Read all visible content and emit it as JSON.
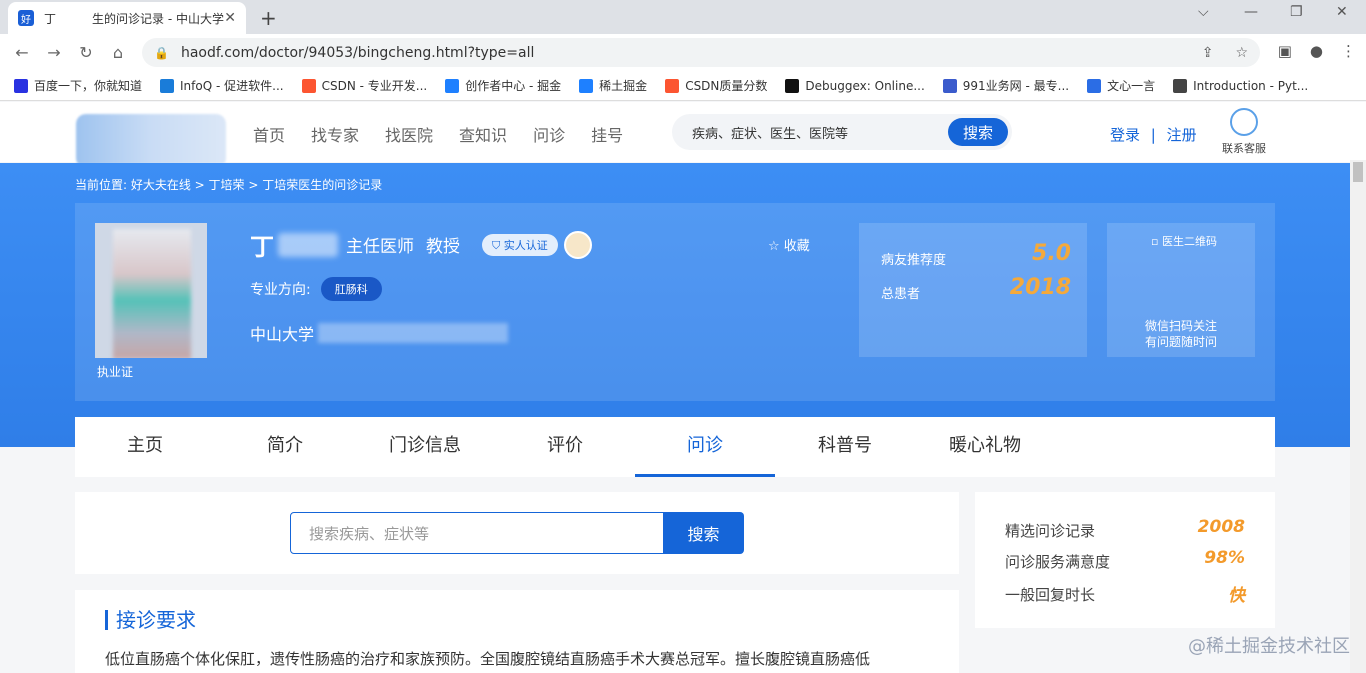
{
  "browser": {
    "tab_title": "丁　　　生的问诊记录 - 中山大学",
    "tab_close": "✕",
    "new_tab": "+",
    "win_min": "⌵",
    "win_minimize": "—",
    "win_restore": "❐",
    "win_close": "✕",
    "url": "haodf.com/doctor/94053/bingcheng.html?type=all",
    "bookmarks": [
      {
        "label": "百度一下，你就知道",
        "icon": "baidu-icon",
        "color": "#2932e1"
      },
      {
        "label": "InfoQ - 促进软件...",
        "icon": "infoq-icon",
        "color": "#1a7cd9"
      },
      {
        "label": "CSDN - 专业开发...",
        "icon": "csdn-icon",
        "color": "#fc5531"
      },
      {
        "label": "创作者中心 - 掘金",
        "icon": "juejin-icon",
        "color": "#1e80ff"
      },
      {
        "label": "稀土掘金",
        "icon": "juejin-icon",
        "color": "#1e80ff"
      },
      {
        "label": "CSDN质量分数",
        "icon": "csdn-icon",
        "color": "#fc5531"
      },
      {
        "label": "Debuggex: Online...",
        "icon": "debuggex-icon",
        "color": "#111111"
      },
      {
        "label": "991业务网 - 最专...",
        "icon": "991-icon",
        "color": "#3b5bcc"
      },
      {
        "label": "文心一言",
        "icon": "wenxin-icon",
        "color": "#2b6de5"
      },
      {
        "label": "Introduction - Pyt...",
        "icon": "python-icon",
        "color": "#444444"
      }
    ]
  },
  "site": {
    "nav": [
      "首页",
      "找专家",
      "找医院",
      "查知识",
      "问诊",
      "挂号"
    ],
    "search_placeholder": "疾病、症状、医生、医院等",
    "search_button": "搜索",
    "login": "登录",
    "separator": "|",
    "register": "注册",
    "service": "联系客服"
  },
  "doctor": {
    "breadcrumb": "当前位置: 好大夫在线  > 丁培荣  > 丁培荣医生的问诊记录",
    "surname": "丁",
    "title": "主任医师",
    "academic": "教授",
    "verified": "实人认证",
    "specialty_label": "专业方向:",
    "specialty_tag": "肛肠科",
    "hospital": "中山大学",
    "license": "执业证",
    "favorite": "☆ 收藏",
    "rec_label": "病友推荐度",
    "rec_value": "5.0",
    "patients_label": "总患者",
    "patients_value": "2018",
    "qr_alt": "医生二维码",
    "qr_caption1": "微信扫码关注",
    "qr_caption2": "有问题随时问"
  },
  "tabs": [
    "主页",
    "简介",
    "门诊信息",
    "评价",
    "问诊",
    "科普号",
    "暖心礼物"
  ],
  "active_tab": "问诊",
  "consult": {
    "search_placeholder": "搜索疾病、症状等",
    "search_button": "搜索"
  },
  "side_stats": [
    {
      "label": "精选问诊记录",
      "value": "2008"
    },
    {
      "label": "问诊服务满意度",
      "value": "98%"
    },
    {
      "label": "一般回复时长",
      "value": "快"
    }
  ],
  "requirements": {
    "heading": "接诊要求",
    "text": "低位直肠癌个体化保肛，遗传性肠癌的治疗和家族预防。全国腹腔镜结直肠癌手术大赛总冠军。擅长腹腔镜直肠癌低"
  },
  "watermark": "@稀土掘金技术社区"
}
